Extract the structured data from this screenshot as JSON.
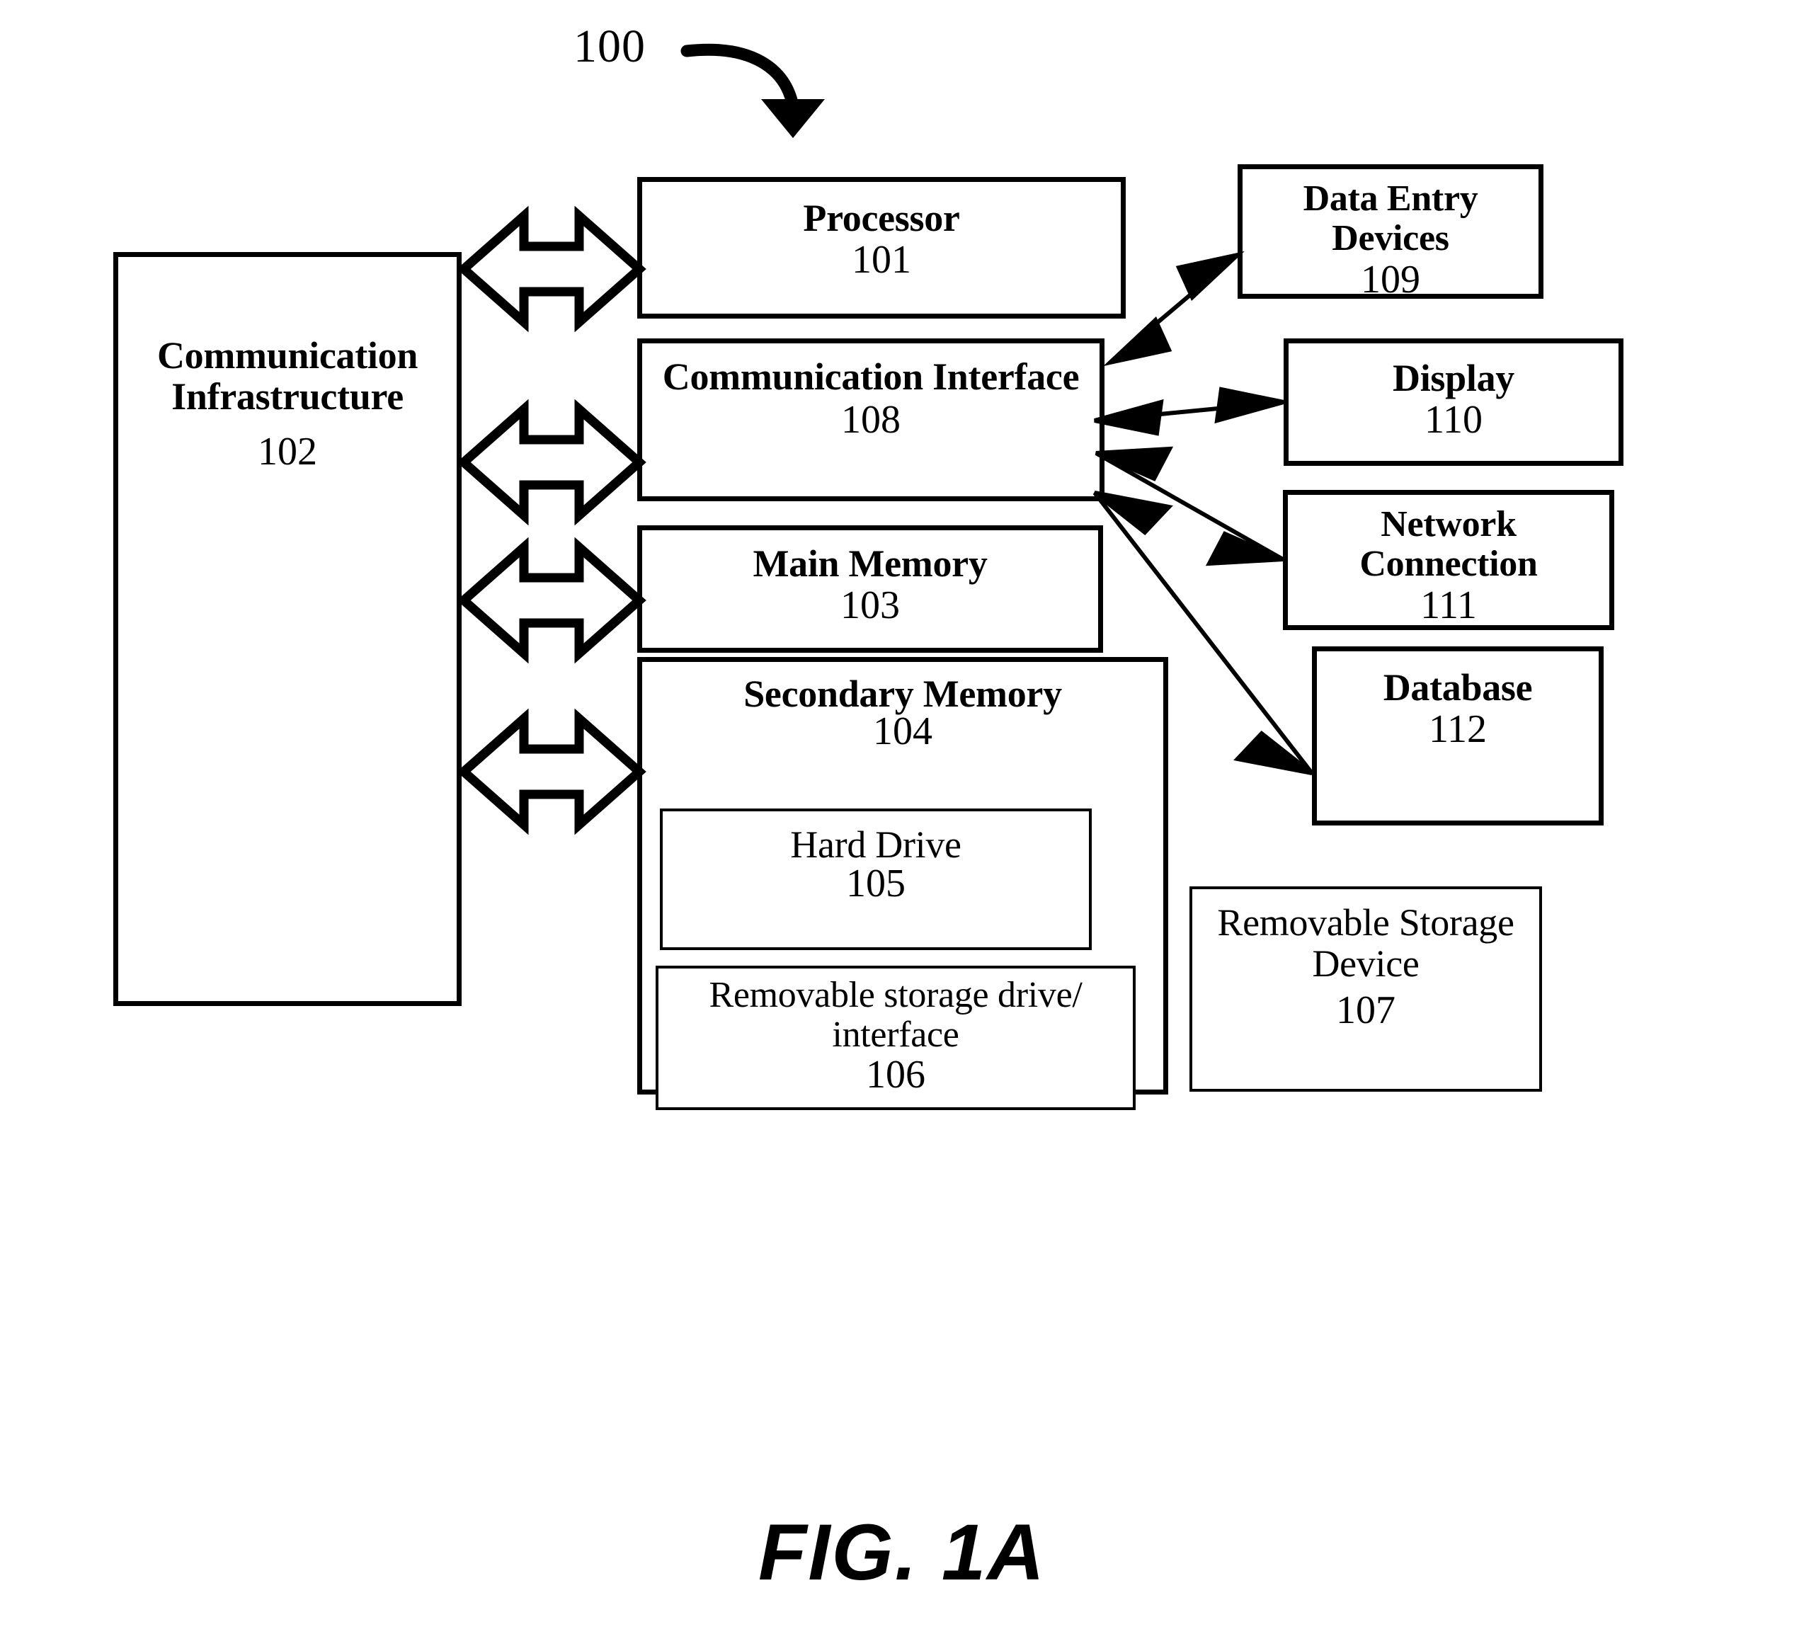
{
  "figure": {
    "caption": "FIG. 1A",
    "reference_numeral": "100"
  },
  "boxes": {
    "communication_infrastructure": {
      "title": "Communication Infrastructure",
      "number": "102"
    },
    "processor": {
      "title": "Processor",
      "number": "101"
    },
    "communication_interface": {
      "title": "Communication Interface",
      "number": "108"
    },
    "main_memory": {
      "title": "Main Memory",
      "number": "103"
    },
    "secondary_memory": {
      "title": "Secondary Memory",
      "number": "104"
    },
    "hard_drive": {
      "title": "Hard Drive",
      "number": "105"
    },
    "removable_storage_drive_interface": {
      "title": "Removable storage drive/ interface",
      "number": "106"
    },
    "data_entry_devices": {
      "title": "Data Entry Devices",
      "number": "109"
    },
    "display": {
      "title": "Display",
      "number": "110"
    },
    "network_connection": {
      "title": "Network Connection",
      "number": "111"
    },
    "database": {
      "title": "Database",
      "number": "112"
    },
    "removable_storage_device": {
      "title": "Removable Storage Device",
      "number": "107"
    }
  },
  "colors": {
    "stroke": "#000000",
    "background": "#ffffff"
  }
}
